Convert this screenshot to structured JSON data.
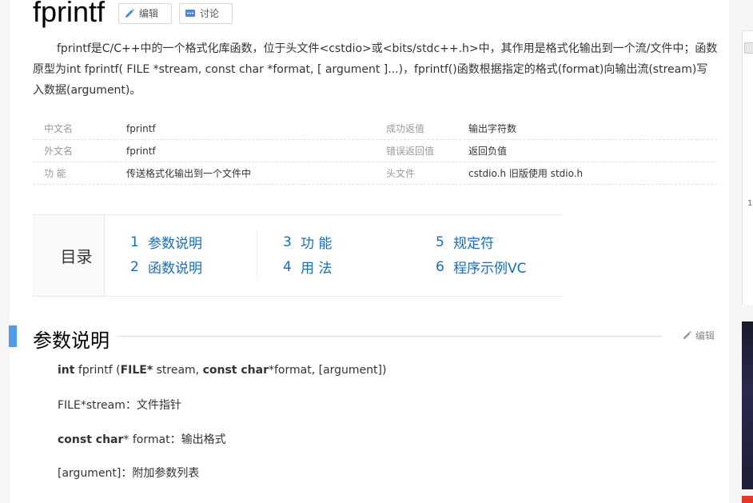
{
  "title": "fprintf",
  "toolbar": {
    "edit_label": "编辑",
    "discuss_label": "讨论"
  },
  "intro": "fprintf是C/C++中的一个格式化库函数，位于头文件<cstdio>或<bits/stdc++.h>中，其作用是格式化输出到一个流/文件中；函数原型为int fprintf( FILE *stream, const char *format, [ argument ]...)，fprintf()函数根据指定的格式(format)向输出流(stream)写入数据(argument)。",
  "info": [
    {
      "k1": "中文名",
      "v1": "fprintf",
      "k2": "成功返值",
      "v2": "输出字符数"
    },
    {
      "k1": "外文名",
      "v1": "fprintf",
      "k2": "错误返回值",
      "v2": "返回负值"
    },
    {
      "k1": "功    能",
      "v1": "传送格式化输出到一个文件中",
      "k2": "头文件",
      "v2": "cstdio.h 旧版使用 stdio.h"
    }
  ],
  "catalog": {
    "label": "目录",
    "items": [
      {
        "num": "1",
        "text": "参数说明"
      },
      {
        "num": "2",
        "text": "函数说明"
      },
      {
        "num": "3",
        "text": "功 能"
      },
      {
        "num": "4",
        "text": "用 法"
      },
      {
        "num": "5",
        "text": "规定符"
      },
      {
        "num": "6",
        "text": "程序示例VC"
      }
    ]
  },
  "section": {
    "title": "参数说明",
    "edit_label": "编辑"
  },
  "params": {
    "line1": {
      "kw1": "int",
      "t1": " fprintf (",
      "kw2": "FILE*",
      "t2": " stream, ",
      "kw3": "const char",
      "t3": "*format, [argument])"
    },
    "line2": "FILE*stream：文件指针",
    "line3": {
      "kw": "const char",
      "t": "* format：输出格式"
    },
    "line4": "[argument]：附加参数列表"
  },
  "side": {
    "tick_1": "1"
  },
  "colors": {
    "link": "#136ec2",
    "section_bar": "#4f9cee"
  }
}
